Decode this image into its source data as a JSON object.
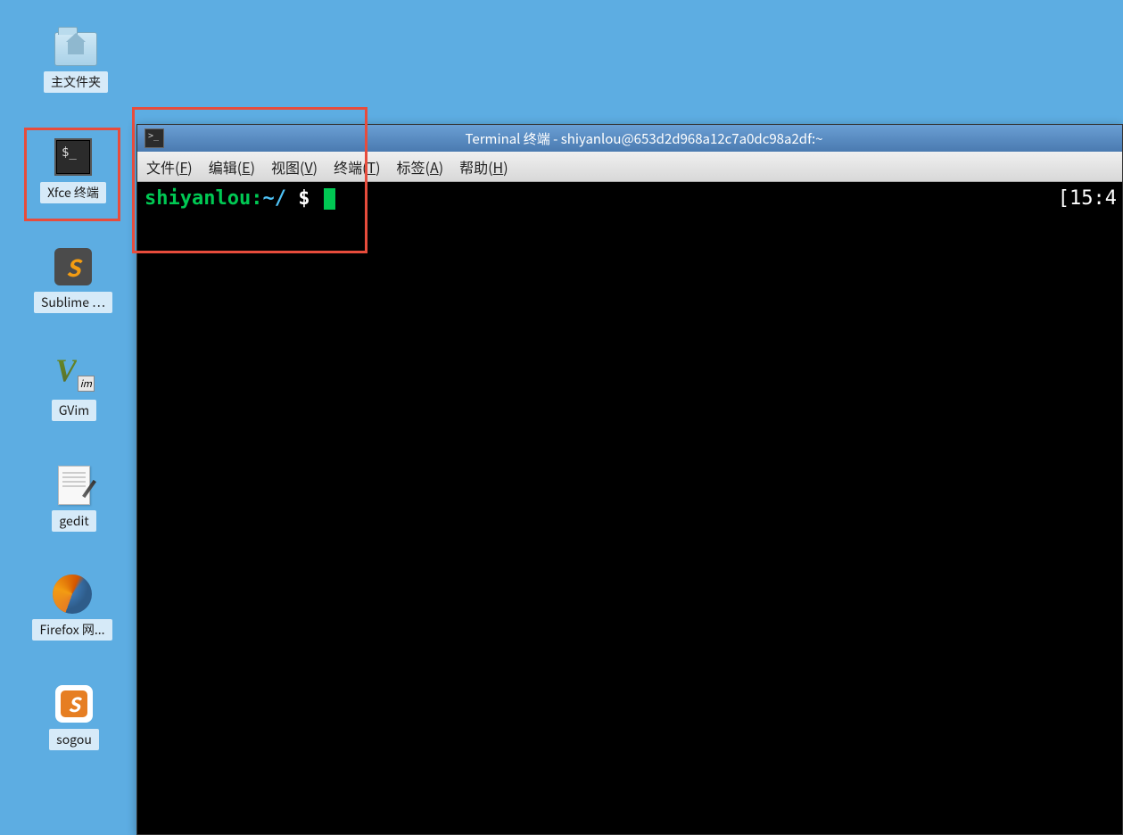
{
  "desktop": {
    "icons": [
      {
        "label": "主文件夹",
        "name": "home-folder",
        "type": "folder"
      },
      {
        "label": "Xfce 终端",
        "name": "xfce-terminal",
        "type": "terminal"
      },
      {
        "label": "Sublime …",
        "name": "sublime-text",
        "type": "sublime"
      },
      {
        "label": "GVim",
        "name": "gvim",
        "type": "gvim"
      },
      {
        "label": "gedit",
        "name": "gedit",
        "type": "gedit"
      },
      {
        "label": "Firefox 网...",
        "name": "firefox",
        "type": "firefox"
      },
      {
        "label": "sogou",
        "name": "sogou",
        "type": "sogou"
      }
    ]
  },
  "terminal_window": {
    "title": "Terminal 终端 - shiyanlou@653d2d968a12c7a0dc98a2df:~",
    "menu": [
      {
        "label": "文件",
        "accel": "F"
      },
      {
        "label": "编辑",
        "accel": "E"
      },
      {
        "label": "视图",
        "accel": "V"
      },
      {
        "label": "终端",
        "accel": "T"
      },
      {
        "label": "标签",
        "accel": "A"
      },
      {
        "label": "帮助",
        "accel": "H"
      }
    ],
    "prompt": {
      "user": "shiyanlou:",
      "path": "~/",
      "dollar": " $ "
    },
    "clock": "[15:4"
  }
}
